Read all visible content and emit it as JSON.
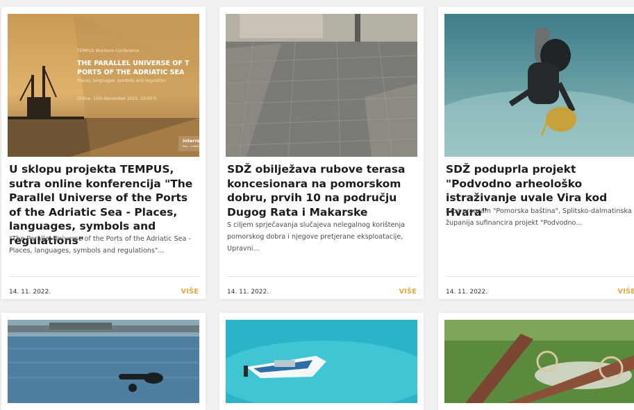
{
  "cards": [
    {
      "title": "U sklopu projekta TEMPUS, sutra online konferencija \"The Parallel Universe of the Ports of the Adriatic Sea - Places, languages, symbols and regulations\"",
      "excerpt": "\"The Parallel Universe of the Ports of the Adriatic Sea - Places, languages, symbols and regulations\"...",
      "date": "14. 11. 2022.",
      "more": "VIŠE",
      "image": {
        "conf_label": "TEMPUS Mid-term Conference",
        "headline_1": "THE PARALLEL UNIVERSE OF T",
        "headline_2": "PORTS OF THE ADRIATIC SEA",
        "subline": "Places, languages, symbols and regulation",
        "when": "Online, 15th November 2022, 10:00 h",
        "logo_text": "interreg",
        "logo_sub": "Italy - Croatia"
      }
    },
    {
      "title": "SDŽ obilježava rubove terasa koncesionara na pomorskom dobru, prvih 10 na području Dugog Rata i Makarske",
      "excerpt": "S ciljem sprječavanja slučajeva nelegalnog korištenja pomorskog dobra i njegove pretjerane eksploatacije, Upravni...",
      "date": "14. 11. 2022.",
      "more": "VIŠE"
    },
    {
      "title": "SDŽ poduprla projekt \"Podvodno arheološko istraživanje uvale Vira kod Hvara\"",
      "excerpt": "Kroz program \"Pomorska baština\", Splitsko-dalmatinska županija sufinancira projekt \"Podvodno...",
      "date": "14. 11. 2022.",
      "more": "VIŠE"
    }
  ]
}
